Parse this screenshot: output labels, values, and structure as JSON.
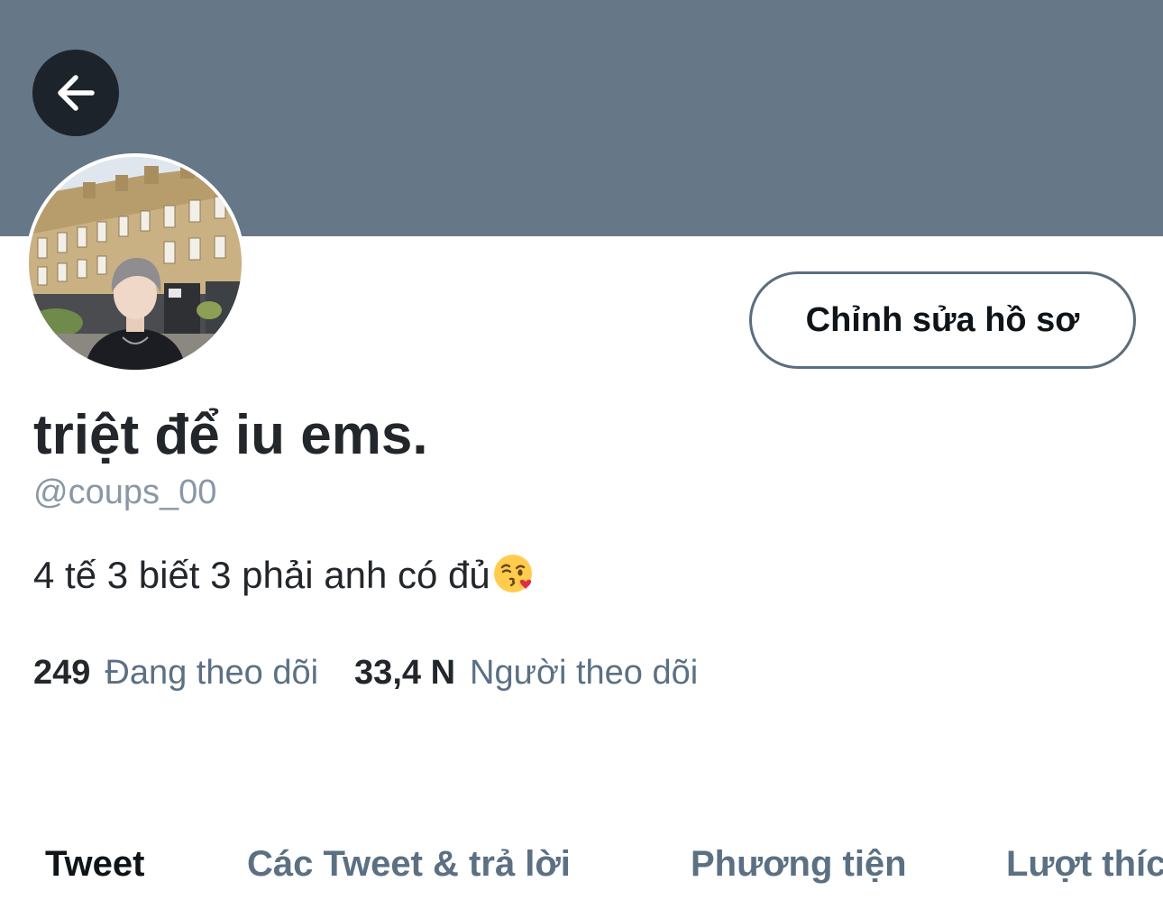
{
  "header": {
    "banner_color": "#667788",
    "back_icon": "arrow-left-icon"
  },
  "profile": {
    "edit_button_label": "Chỉnh sửa hồ sơ",
    "display_name": "triệt để iu ems.",
    "handle": "@coups_00",
    "bio_text": "4 tế 3 biết 3 phải anh có đủ",
    "bio_emoji": "face-blowing-kiss-emoji"
  },
  "stats": {
    "following_count": "249",
    "following_label": "Đang theo dõi",
    "followers_count": "33,4 N",
    "followers_label": "Người theo dõi"
  },
  "tabs": [
    {
      "label": "Tweet",
      "active": true
    },
    {
      "label": "Các Tweet & trả lời",
      "active": false
    },
    {
      "label": "Phương tiện",
      "active": false
    },
    {
      "label": "Lượt thích",
      "active": false
    }
  ]
}
